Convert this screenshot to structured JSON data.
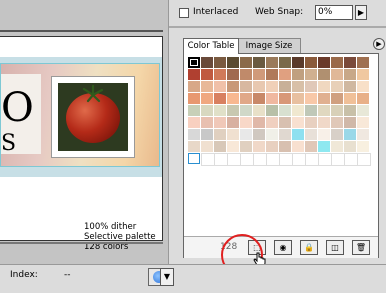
{
  "options": {
    "interlaced_label": "Interlaced",
    "websnap_label": "Web Snap:",
    "websnap_value": "0%"
  },
  "tabs": [
    {
      "label": "Color Table"
    },
    {
      "label": "Image Size"
    }
  ],
  "document": {
    "letters": [
      "O",
      "S"
    ],
    "info": [
      "100% dither",
      "Selective palette",
      "128 colors"
    ]
  },
  "palette": {
    "count": "128",
    "swatches": [
      "#4a2a20",
      "#6a4a3a",
      "#7a5a40",
      "#5a4a30",
      "#8a6a4a",
      "#6a5a40",
      "#9a7a5a",
      "#7a6a4a",
      "#5a3a2a",
      "#8a5a3a",
      "#6a3a2a",
      "#9a6a4a",
      "#7a4a3a",
      "#a07050",
      "#b04030",
      "#c05a40",
      "#d07a5a",
      "#a06a50",
      "#c08a6a",
      "#d09a7a",
      "#b07a5a",
      "#e0a080",
      "#c0a080",
      "#d0b090",
      "#b09070",
      "#e0b898",
      "#c8a888",
      "#f0c8a0",
      "#d8a888",
      "#e8b898",
      "#f0c0a8",
      "#c89878",
      "#d8b8a0",
      "#e8c8b0",
      "#f0d0b8",
      "#c8b098",
      "#d8c0a8",
      "#e0c8b8",
      "#f0d8c0",
      "#e8d0b8",
      "#d0b8a0",
      "#f8e0c8",
      "#e89870",
      "#f0a880",
      "#d88060",
      "#f8b890",
      "#e0a888",
      "#c88868",
      "#f0b8a0",
      "#d89878",
      "#e8c0a0",
      "#f8c8a8",
      "#e0b090",
      "#d0a080",
      "#f0c098",
      "#e8b088",
      "#c8d0b8",
      "#d8d8c0",
      "#e0e0c8",
      "#c8c8b0",
      "#d0d8c8",
      "#e8e0c8",
      "#b8c0a8",
      "#d8e0d0",
      "#f0e8d0",
      "#c0c8b8",
      "#e0d8c0",
      "#d8d0b8",
      "#c8c0a8",
      "#e8e8d8",
      "#f8d0c0",
      "#e8c0b0",
      "#f0c8b8",
      "#d8b0a0",
      "#f8d8c8",
      "#e0b8a8",
      "#f0d0c0",
      "#d8c0b0",
      "#f8e0d0",
      "#e8d0c0",
      "#f0d8c8",
      "#e0c8b8",
      "#d0b8a8",
      "#f8e8d8",
      "#d8d8d8",
      "#c8c8c8",
      "#e0d0c0",
      "#f0e0d0",
      "#e8e8e8",
      "#d0c8c0",
      "#f0f0e8",
      "#e0d8d0",
      "#8ee0f0",
      "#e8e0d8",
      "#f8f0e8",
      "#d8d0c8",
      "#9ad8e8",
      "#f0e8e0",
      "#e8d8c8",
      "#f0e0d0",
      "#d8c8b8",
      "#f8e8d8",
      "#e0d0c0",
      "#f0d8c8",
      "#e8d0c0",
      "#d8c0b0",
      "#f8e0d0",
      "#e0c8b8",
      "#8ee8f0",
      "#f0e8d8",
      "#e8e0d0",
      "#f8f0e0",
      "#ffffff",
      "#ffffff",
      "#ffffff",
      "#ffffff",
      "#ffffff",
      "#ffffff",
      "#ffffff",
      "#ffffff",
      "#ffffff",
      "#ffffff",
      "#ffffff",
      "#ffffff",
      "#ffffff",
      "#ffffff"
    ]
  },
  "footer_buttons": [
    {
      "name": "web-shift-button",
      "glyph": "⬚"
    },
    {
      "name": "web-safe-cube-button",
      "glyph": "◉"
    },
    {
      "name": "lock-color-button",
      "glyph": "🔒"
    },
    {
      "name": "new-color-button",
      "glyph": "◫"
    },
    {
      "name": "delete-color-button",
      "glyph": "🗑"
    }
  ],
  "status": {
    "index_label": "Index:",
    "index_value": "--"
  },
  "colors": {
    "highlight": "#e02020",
    "selected_swatch_border": "#2a8fd0"
  }
}
